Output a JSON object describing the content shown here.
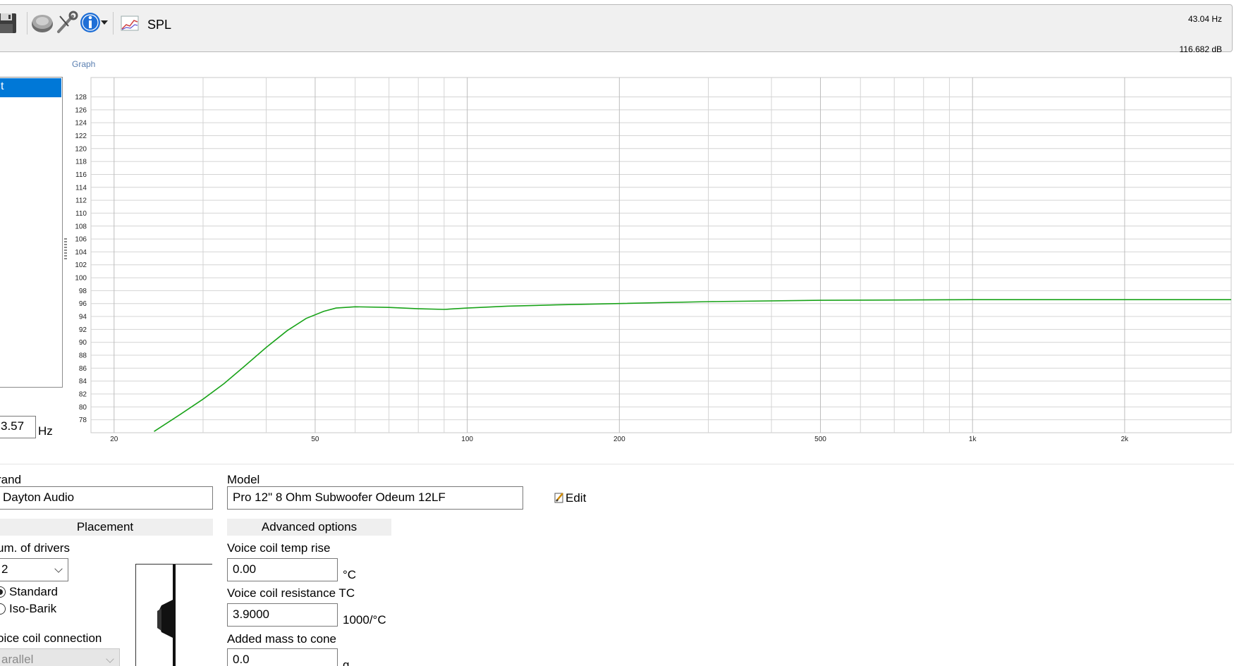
{
  "toolbar": {
    "spl_label": "SPL",
    "icons": [
      "save-icon",
      "driver-icon",
      "tools-icon",
      "info-icon",
      "dropdown-arrow-icon",
      "spl-graph-icon"
    ]
  },
  "readouts": {
    "frequency": "43.04 Hz",
    "spl": "116.682 dB"
  },
  "left_panel": {
    "selected_item": "t",
    "frequency_value": "3.57",
    "frequency_unit": "Hz"
  },
  "graph": {
    "caption": "Graph",
    "line_color": "#19a319"
  },
  "chart_data": {
    "type": "line",
    "x_scale": "log",
    "xlim": [
      18,
      3250
    ],
    "ylim": [
      76,
      131
    ],
    "x_ticks": [
      {
        "value": 20,
        "label": "20"
      },
      {
        "value": 50,
        "label": "50"
      },
      {
        "value": 100,
        "label": "100"
      },
      {
        "value": 200,
        "label": "200"
      },
      {
        "value": 500,
        "label": "500"
      },
      {
        "value": 1000,
        "label": "1k"
      },
      {
        "value": 2000,
        "label": "2k"
      }
    ],
    "x_minor": [
      30,
      40,
      60,
      70,
      80,
      90,
      300,
      400,
      600,
      700,
      800,
      900
    ],
    "y_ticks": [
      78,
      80,
      82,
      84,
      86,
      88,
      90,
      92,
      94,
      96,
      98,
      100,
      102,
      104,
      106,
      108,
      110,
      112,
      114,
      116,
      118,
      120,
      122,
      124,
      126,
      128
    ],
    "grid": true,
    "series": [
      {
        "color": "#19a319",
        "x": [
          24,
          27,
          30,
          33,
          36,
          40,
          44,
          48,
          52,
          55,
          60,
          70,
          80,
          90,
          100,
          120,
          150,
          200,
          300,
          500,
          1000,
          2000,
          3250
        ],
        "y": [
          76.2,
          78.8,
          81.2,
          83.6,
          86.1,
          89.2,
          91.8,
          93.7,
          94.8,
          95.3,
          95.5,
          95.4,
          95.2,
          95.1,
          95.3,
          95.6,
          95.8,
          96.0,
          96.3,
          96.5,
          96.6,
          96.6,
          96.6
        ]
      }
    ]
  },
  "driver": {
    "brand_label": "rand",
    "brand_value": "Dayton Audio",
    "model_label": "Model",
    "model_value": "Pro 12\" 8 Ohm Subwoofer Odeum 12LF",
    "edit_label": "Edit"
  },
  "placement": {
    "header": "Placement",
    "num_drivers_label": "um. of drivers",
    "num_drivers_value": "2",
    "option_standard": "Standard",
    "option_isobarik": "Iso-Barik",
    "voice_coil_connection_label": "oice coil connection",
    "voice_coil_connection_value": "arallel"
  },
  "advanced": {
    "header": "Advanced options",
    "vc_temp_rise_label": "Voice coil temp rise",
    "vc_temp_rise_value": "0.00",
    "vc_temp_rise_unit": "°C",
    "vc_resistance_tc_label": "Voice coil resistance TC",
    "vc_resistance_tc_value": "3.9000",
    "vc_resistance_tc_unit": "1000/°C",
    "added_mass_label": "Added mass to cone",
    "added_mass_value": "0.0",
    "added_mass_unit": "g"
  }
}
